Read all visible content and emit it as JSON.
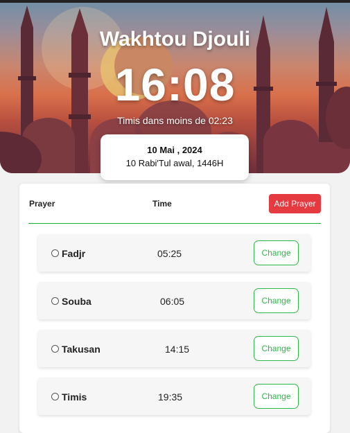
{
  "header": {
    "title": "Wakhtou Djouli",
    "current_time": "16:08",
    "next_prayer_text": "Timis dans moins de 02:23"
  },
  "date": {
    "gregorian": "10 Mai , 2024",
    "hijri": "10 Rabi'Tul awal, 1446H"
  },
  "table": {
    "col_prayer": "Prayer",
    "col_time": "Time",
    "add_label": "Add Prayer"
  },
  "prayers": [
    {
      "name": "Fadjr",
      "time": "05:25",
      "action": "Change"
    },
    {
      "name": "Souba",
      "time": "06:05",
      "action": "Change"
    },
    {
      "name": "Takusan",
      "time": "14:15",
      "action": "Change"
    },
    {
      "name": "Timis",
      "time": "19:35",
      "action": "Change"
    }
  ],
  "colors": {
    "add_button": "#e53a40",
    "change_button": "#2eb84a",
    "divider": "#1fae3a"
  }
}
